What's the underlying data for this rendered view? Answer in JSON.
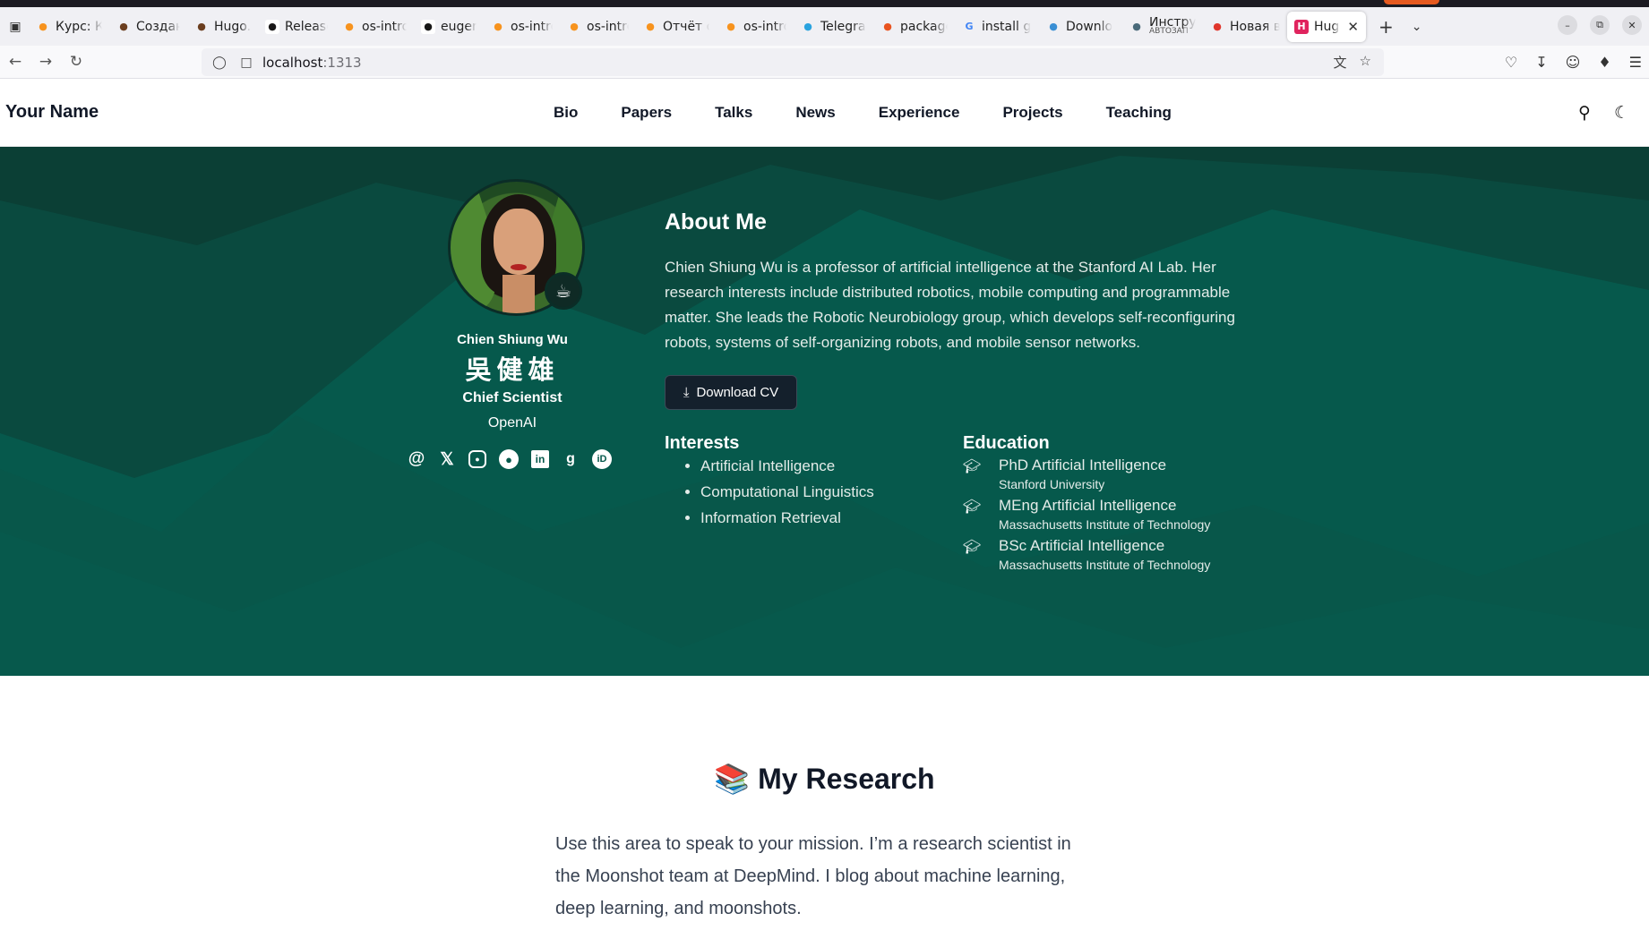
{
  "browser": {
    "tabs": [
      {
        "title": "Курс: Ко",
        "icon": "moodle-icon",
        "color": "#f7931e"
      },
      {
        "title": "Создан",
        "icon": "pig-icon",
        "color": "#6b3e1f"
      },
      {
        "title": "Hugo. Li",
        "icon": "pig-icon",
        "color": "#6b3e1f"
      },
      {
        "title": "Release",
        "icon": "github-icon",
        "color": "#181717"
      },
      {
        "title": "os-intro",
        "icon": "moodle-icon",
        "color": "#f7931e"
      },
      {
        "title": "eugern",
        "icon": "github-icon",
        "color": "#181717"
      },
      {
        "title": "os-intro",
        "icon": "moodle-icon",
        "color": "#f7931e"
      },
      {
        "title": "os-intro",
        "icon": "moodle-icon",
        "color": "#f7931e"
      },
      {
        "title": "Отчёт о",
        "icon": "moodle-icon",
        "color": "#f7931e"
      },
      {
        "title": "os-intro",
        "icon": "moodle-icon",
        "color": "#f7931e"
      },
      {
        "title": "Telegra",
        "icon": "telegram-icon",
        "color": "#2aa3df"
      },
      {
        "title": "package",
        "icon": "askubuntu-icon",
        "color": "#e95420"
      },
      {
        "title": "install g",
        "icon": "google-icon",
        "color": "#4285f4"
      },
      {
        "title": "Downlo",
        "icon": "download-page-icon",
        "color": "#3a8fd4"
      },
      {
        "title": "Инстру",
        "subtitle": "АВТОЗАП",
        "icon": "doc-icon",
        "color": "#4a6a7a"
      },
      {
        "title": "Новая в",
        "icon": "firefox-icon",
        "color": "#e0362c"
      },
      {
        "title": "Hugo",
        "icon": "hugo-icon",
        "color": "#e0245e",
        "active": true
      }
    ],
    "url_host": "localhost",
    "url_port": ":1313"
  },
  "site": {
    "brand": "Your Name",
    "menu": [
      "Bio",
      "Papers",
      "Talks",
      "News",
      "Experience",
      "Projects",
      "Teaching"
    ]
  },
  "profile": {
    "name": "Chien Shiung Wu",
    "name_zh": "吳健雄",
    "role": "Chief Scientist",
    "org": "OpenAI",
    "status_emoji": "☕"
  },
  "about": {
    "heading": "About Me",
    "bio": "Chien Shiung Wu is a professor of artificial intelligence at the Stanford AI Lab. Her research interests include distributed robotics, mobile computing and programmable matter. She leads the Robotic Neurobiology group, which develops self-reconfiguring robots, systems of self-organizing robots, and mobile sensor networks.",
    "cv_button": "Download CV",
    "interests_heading": "Interests",
    "interests": [
      "Artificial Intelligence",
      "Computational Linguistics",
      "Information Retrieval"
    ],
    "education_heading": "Education",
    "education": [
      {
        "degree": "PhD Artificial Intelligence",
        "institution": "Stanford University"
      },
      {
        "degree": "MEng Artificial Intelligence",
        "institution": "Massachusetts Institute of Technology"
      },
      {
        "degree": "BSc Artificial Intelligence",
        "institution": "Massachusetts Institute of Technology"
      }
    ]
  },
  "research": {
    "heading": "📚 My Research",
    "text": "Use this area to speak to your mission. I’m a research scientist in the Moonshot team at DeepMind. I blog about machine learning, deep learning, and moonshots."
  },
  "colors": {
    "hero_bg": "#06594c",
    "hero_dark": "#0b3d34",
    "text_dark": "#111827"
  }
}
